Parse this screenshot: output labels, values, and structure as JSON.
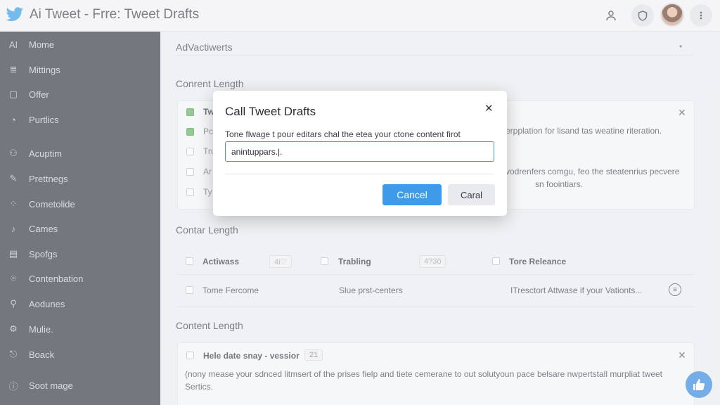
{
  "header": {
    "title": "Ai Tweet - Frre: Tweet Drafts",
    "icons": [
      "twitter-bird-icon",
      "user-icon",
      "shield-icon",
      "avatar",
      "more-icon"
    ]
  },
  "sidebar": {
    "items": [
      {
        "label": "Mome",
        "icon_text": "AI"
      },
      {
        "label": "Mittings",
        "icon_text": "≣"
      },
      {
        "label": "Offer",
        "icon_text": "▢"
      },
      {
        "label": "Purtlics",
        "icon_text": "◔"
      },
      {
        "label": "Acuptim",
        "icon_text": "⚇"
      },
      {
        "label": "Prettnegs",
        "icon_text": "✎"
      },
      {
        "label": "Cometolide",
        "icon_text": "⁘"
      },
      {
        "label": "Cames",
        "icon_text": "♪"
      },
      {
        "label": "Spofgs",
        "icon_text": "▤"
      },
      {
        "label": "Contenbation",
        "icon_text": "⌾"
      },
      {
        "label": "Aodunes",
        "icon_text": "⚲"
      },
      {
        "label": "Mulie.",
        "icon_text": "⚙"
      },
      {
        "label": "Boack",
        "icon_text": "⎋"
      },
      {
        "label": "Soot mage",
        "icon_text": "ⓘ"
      }
    ]
  },
  "main": {
    "section1_title": "AdVactiwerts",
    "section1_dot": "•",
    "section2_title": "Conrent Length",
    "panel1": {
      "row1_prefix": "Tw",
      "row2_prefix": "Pc",
      "row3_prefix": "Tru",
      "row4_prefix": "Ar",
      "row5_prefix": "Ty",
      "right_text_1": "erpplation for lisand tas weatine riteration.",
      "right_text_2": "vodrenfers comgu, feo the steatenrius pecvere",
      "right_text_3": "sn foointiars."
    },
    "section3_title": "Contar Length",
    "table": {
      "headers": [
        "Actiwass",
        "Trabling",
        "Tore Releance"
      ],
      "pill1": "4i♡",
      "pill2": "4?3ö",
      "row": [
        "Tome Fercome",
        "Slue prst-centers",
        "ITresctort Attwase if your Vationts..."
      ]
    },
    "section4_title": "Content Length",
    "panel2": {
      "title": "Hele date snay - vessior",
      "badge": "21",
      "body_1": "(nony mease your sdnced litmsert of the prises fielp and tiete cemerane to out solutyoun pace belsare nwpertstall murpliat tweet",
      "body_2": "Sertics."
    }
  },
  "modal": {
    "title": "Call Tweet Drafts",
    "label": "Tone flwage t pour editars chal the etea your ctone content firot",
    "input_value": "anintuppars.|.",
    "primary_label": "Cancel",
    "secondary_label": "Caral"
  },
  "colors": {
    "accent": "#3d9bea",
    "sidebar_bg": "#2e333d",
    "check_green": "#5fb15f"
  }
}
